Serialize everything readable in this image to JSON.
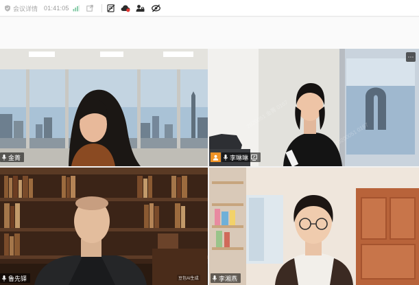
{
  "topbar": {
    "meeting_info_label": "会议详情",
    "elapsed_time": "01:41:05"
  },
  "tiles": [
    {
      "name": "金菁",
      "active": true,
      "mic": "on"
    },
    {
      "name": "李琳琳",
      "active": false,
      "mic": "on",
      "status_icon": "person-icon",
      "share_icon": "screen-share-icon"
    },
    {
      "name": "鲁先铎",
      "active": false,
      "mic": "on",
      "ai_label": "豆包AI生成"
    },
    {
      "name": "李湘燕",
      "active": false,
      "mic": "on"
    }
  ],
  "watermark": {
    "text_a": "2020051 金菁 0167",
    "text_b": "20200051 0167"
  },
  "colors": {
    "active_border": "#45d49a",
    "badge_orange": "#f09326"
  }
}
